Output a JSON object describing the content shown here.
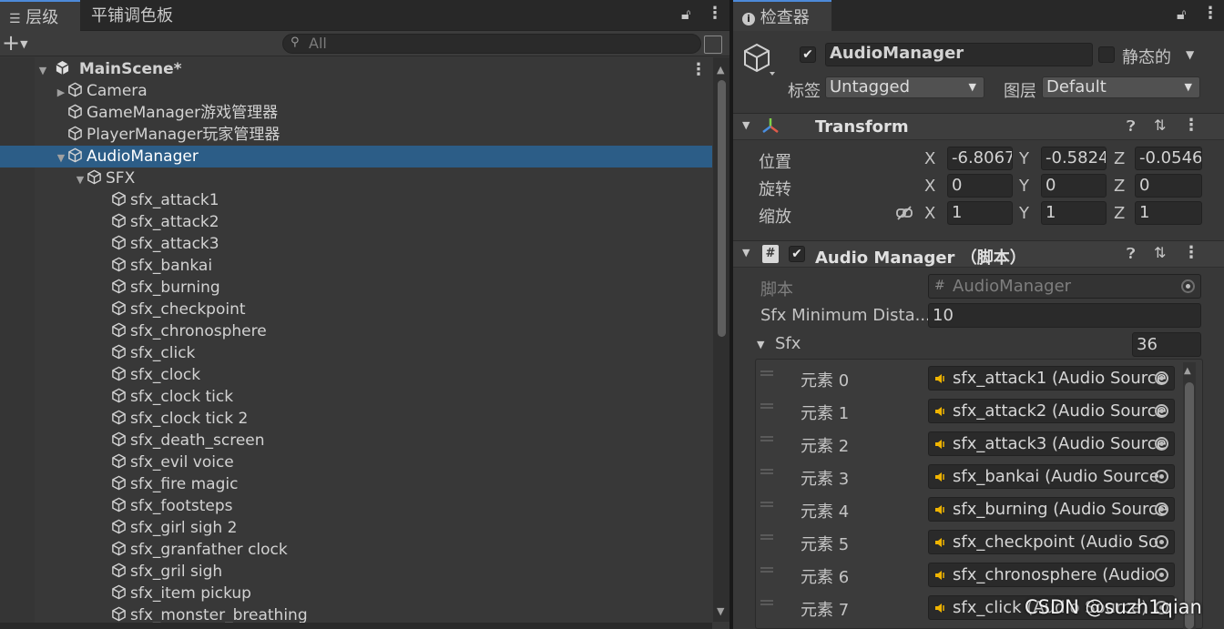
{
  "hierarchy": {
    "tab_label": "层级",
    "tab2_label": "平铺调色板",
    "search_placeholder": "All",
    "scene": "MainScene*",
    "objects": [
      "Camera",
      "GameManager游戏管理器",
      "PlayerManager玩家管理器",
      "AudioManager"
    ],
    "sfx_folder": "SFX",
    "sfx_items": [
      "sfx_attack1",
      "sfx_attack2",
      "sfx_attack3",
      "sfx_bankai",
      "sfx_burning",
      "sfx_checkpoint",
      "sfx_chronosphere",
      "sfx_click",
      "sfx_clock",
      "sfx_clock tick",
      "sfx_clock tick 2",
      "sfx_death_screen",
      "sfx_evil voice",
      "sfx_fire magic",
      "sfx_footsteps",
      "sfx_girl sigh 2",
      "sfx_granfather clock",
      "sfx_gril sigh",
      "sfx_item pickup",
      "sfx_monster_breathing"
    ]
  },
  "inspector": {
    "tab_label": "检查器",
    "object_name": "AudioManager",
    "static_label": "静态的",
    "tag_label": "标签",
    "tag_value": "Untagged",
    "layer_label": "图层",
    "layer_value": "Default",
    "transform": {
      "title": "Transform",
      "position_label": "位置",
      "rotation_label": "旋转",
      "scale_label": "缩放",
      "x": "X",
      "y": "Y",
      "z": "Z",
      "position": [
        "-6.8067",
        "-0.5824",
        "-0.0546"
      ],
      "rotation": [
        "0",
        "0",
        "0"
      ],
      "scale": [
        "1",
        "1",
        "1"
      ]
    },
    "script_comp": {
      "title": "Audio Manager （脚本）",
      "script_label": "脚本",
      "script_value": "AudioManager",
      "min_dist_label": "Sfx Minimum Dista...",
      "min_dist_value": "10",
      "sfx_label": "Sfx",
      "sfx_count": "36",
      "elements": [
        {
          "label": "元素 0",
          "value": "sfx_attack1 (Audio Source"
        },
        {
          "label": "元素 1",
          "value": "sfx_attack2 (Audio Source"
        },
        {
          "label": "元素 2",
          "value": "sfx_attack3 (Audio Source"
        },
        {
          "label": "元素 3",
          "value": "sfx_bankai (Audio Source"
        },
        {
          "label": "元素 4",
          "value": "sfx_burning (Audio Source"
        },
        {
          "label": "元素 5",
          "value": "sfx_checkpoint (Audio So"
        },
        {
          "label": "元素 6",
          "value": "sfx_chronosphere (Audio"
        },
        {
          "label": "元素 7",
          "value": "sfx_click (Audio Source)"
        }
      ]
    }
  },
  "watermark": "CSDN @suzh1qian",
  "colors": {
    "selection": "#2c5d87",
    "panel": "#383838",
    "audio_icon": "#f0b400"
  }
}
